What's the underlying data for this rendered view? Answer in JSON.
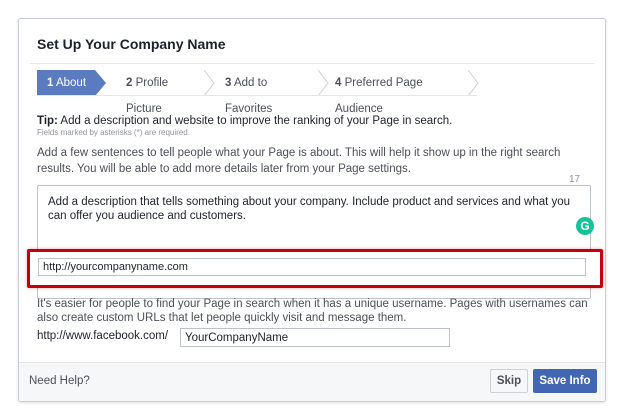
{
  "dialog": {
    "title": "Set Up Your Company Name"
  },
  "steps": [
    {
      "num": "1",
      "label": "About"
    },
    {
      "num": "2",
      "label": "Profile Picture"
    },
    {
      "num": "3",
      "label": "Add to Favorites"
    },
    {
      "num": "4",
      "label": "Preferred Page Audience"
    }
  ],
  "tip": {
    "prefix": "Tip:",
    "text": " Add a description and website to improve the ranking of your Page in search.",
    "required_note": "Fields marked by asterisks (*) are required."
  },
  "intro": "Add a few sentences to tell people what your Page is about. This will help it show up in the right search results. You will be able to add more details later from your Page settings.",
  "description": {
    "char_counter": "17",
    "placeholder": "Add a description that tells something about your company. Include product and services and what you can offer you audience and customers.",
    "grammarly_letter": "G"
  },
  "website": {
    "value": "http://yourcompanyname.com"
  },
  "username": {
    "help": "It's easier for people to find your Page in search when it has a unique username. Pages with usernames can also create custom URLs that let people quickly visit and message them.",
    "prefix": "http://www.facebook.com/",
    "value": "YourCompanyName"
  },
  "footer": {
    "need_help": "Need Help?",
    "skip_label": "Skip",
    "save_label": "Save Info"
  },
  "colors": {
    "active_step": "#5b7bc0",
    "highlight_border": "#c4000c",
    "save_button": "#4267b2",
    "grammarly": "#15c39a"
  }
}
